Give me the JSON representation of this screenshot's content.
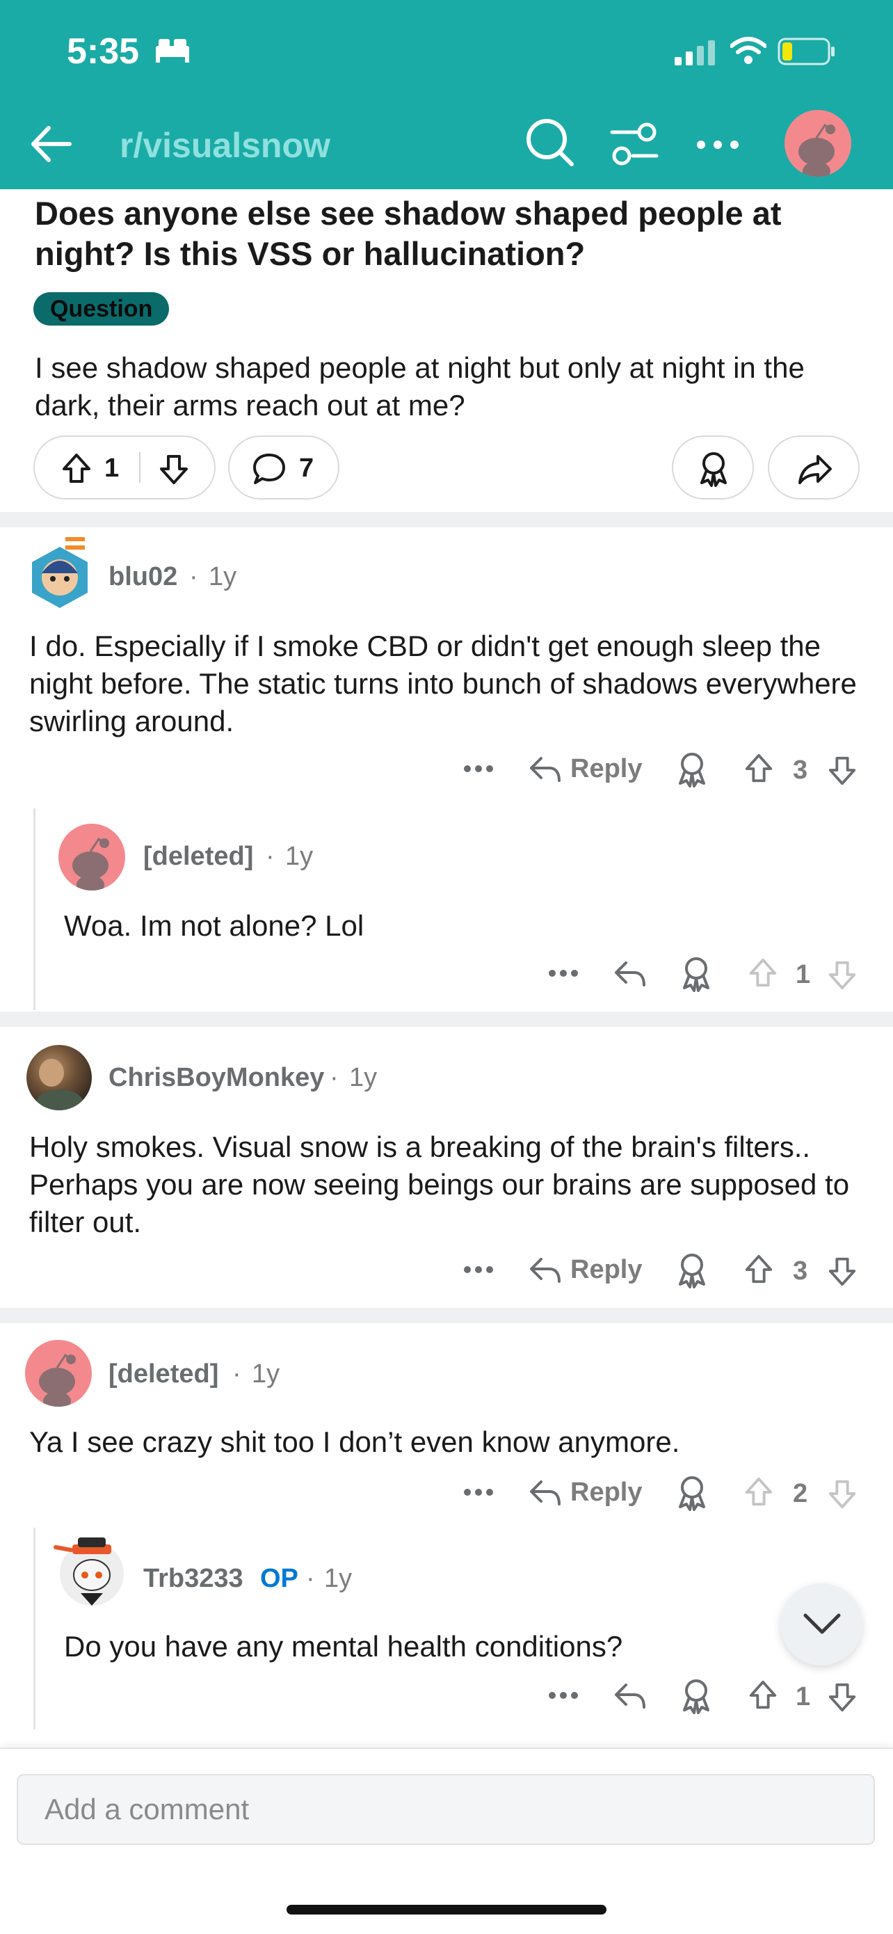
{
  "status_bar": {
    "time": "5:35"
  },
  "header": {
    "subreddit": "r/visualsnow"
  },
  "post": {
    "title": "Does anyone else see shadow shaped people at night? Is this VSS or hallucination?",
    "flair": "Question",
    "body": "I see shadow shaped people at night but only at night in the dark, their arms reach out at me?",
    "votes": "1",
    "comments": "7"
  },
  "comments": [
    {
      "user": "blu02",
      "age": "1y",
      "body": "I do. Especially if I smoke CBD or didn't get enough sleep the night before. The static turns into bunch of shadows everywhere swirling around.",
      "reply_label": "Reply",
      "score": "3"
    },
    {
      "user": "[deleted]",
      "age": "1y",
      "body": "Woa. Im not alone? Lol",
      "score": "1"
    },
    {
      "user": "ChrisBoyMonkey",
      "age": "1y",
      "body": "Holy smokes. Visual snow is a breaking of the brain's filters.. Perhaps you are now seeing beings our brains are supposed to filter out.",
      "reply_label": "Reply",
      "score": "3"
    },
    {
      "user": "[deleted]",
      "age": "1y",
      "body": "Ya I see crazy shit too I don’t even know anymore.",
      "reply_label": "Reply",
      "score": "2"
    },
    {
      "user": "Trb3233",
      "op_tag": "OP",
      "age": "1y",
      "body": "Do you have any mental health conditions?",
      "score": "1"
    }
  ],
  "composer": {
    "placeholder": "Add a comment"
  },
  "colors": {
    "header_bg": "#1aaba6",
    "flair_bg": "#0b6b6b",
    "op_blue": "#0079d3"
  }
}
